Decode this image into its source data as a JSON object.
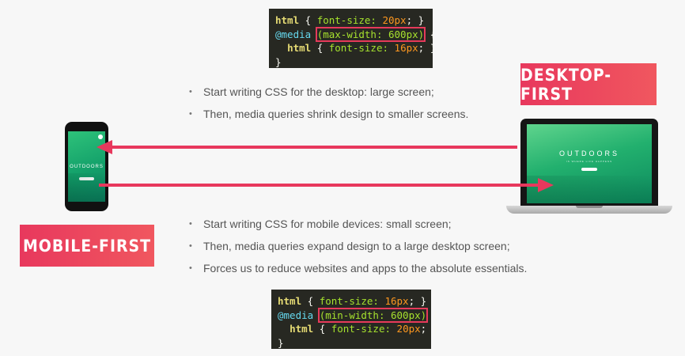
{
  "desktop_code": {
    "line1": {
      "sel": "html",
      "open": " { ",
      "prop": "font-size:",
      "val": " 20px",
      "close": "; }"
    },
    "line2": {
      "at": "@media ",
      "hl": "(max-width: 600px)",
      "rest": " {"
    },
    "line3": {
      "indent": "  ",
      "sel": "html",
      "open": " { ",
      "prop": "font-size:",
      "val": " 16px",
      "close": "; }"
    },
    "line4": "}"
  },
  "mobile_code": {
    "line1": {
      "sel": "html",
      "open": " { ",
      "prop": "font-size:",
      "val": " 16px",
      "close": "; }"
    },
    "line2": {
      "at": "@media ",
      "hl": "(min-width: 600px)",
      "rest": " {"
    },
    "line3": {
      "indent": "  ",
      "sel": "html",
      "open": " { ",
      "prop": "font-size:",
      "val": " 20px",
      "close": "; }"
    },
    "line4": "}"
  },
  "desktop_first": {
    "label": "DESKTOP-FIRST",
    "bullets": [
      "Start writing CSS for the desktop: large screen;",
      "Then, media queries shrink design to smaller screens."
    ]
  },
  "mobile_first": {
    "label": "MOBILE-FIRST",
    "bullets": [
      "Start writing CSS for mobile devices: small screen;",
      "Then, media queries expand design to a large desktop screen;",
      "Forces us to reduce websites and apps to the absolute essentials."
    ]
  },
  "devices": {
    "laptop_screen_title": "OUTDOORS",
    "laptop_screen_subtitle": "IS WHERE LIFE HAPPENS",
    "phone_screen_title": "OUTDOORS"
  },
  "colors": {
    "accent": "#e8385d",
    "arrow": "#e8385d",
    "code_bg": "#272822",
    "screen_green": "#22b06e"
  },
  "icons": {
    "arrow_left": "arrow-left-icon",
    "arrow_right": "arrow-right-icon"
  }
}
